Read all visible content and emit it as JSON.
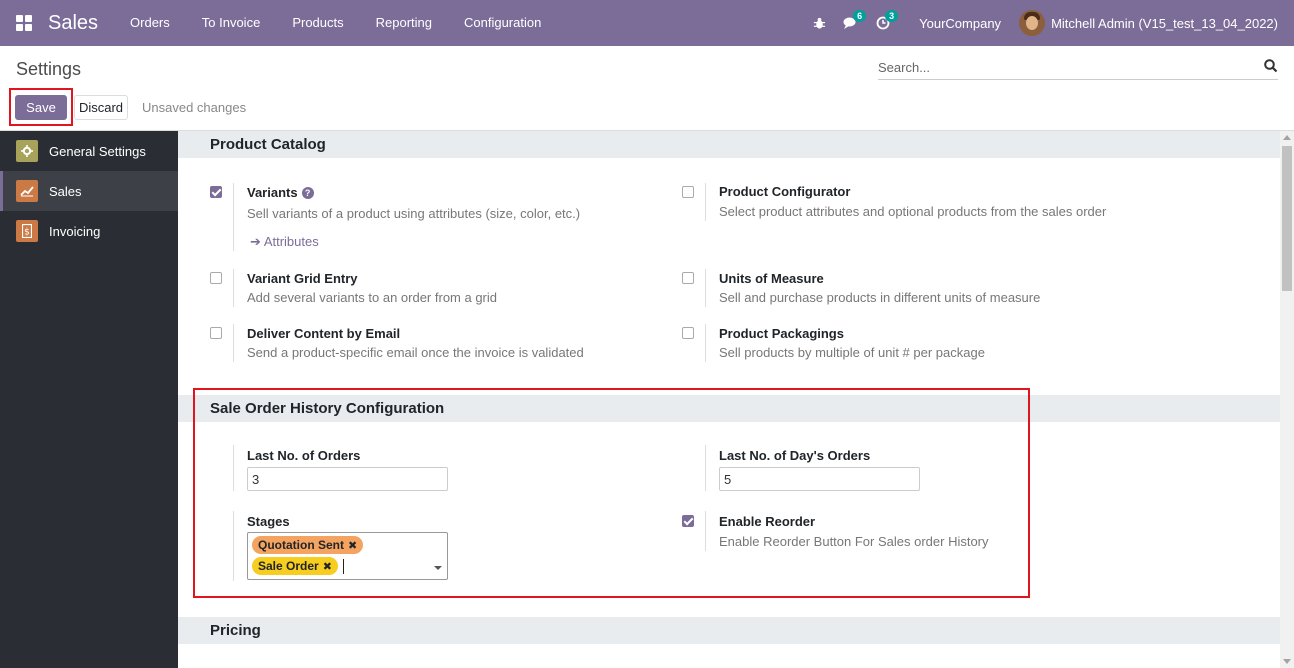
{
  "navbar": {
    "app_name": "Sales",
    "menu": [
      "Orders",
      "To Invoice",
      "Products",
      "Reporting",
      "Configuration"
    ],
    "messages_count": "6",
    "activities_count": "3",
    "company": "YourCompany",
    "user": "Mitchell Admin (V15_test_13_04_2022)",
    "color": "#7c6d98"
  },
  "control": {
    "title": "Settings",
    "search_placeholder": "Search...",
    "save_label": "Save",
    "discard_label": "Discard",
    "unsaved_label": "Unsaved changes"
  },
  "sidebar": {
    "items": [
      {
        "label": "General Settings",
        "icon": "gear-icon",
        "color": "#a8a35a"
      },
      {
        "label": "Sales",
        "icon": "chart-icon",
        "color": "#cc7a45"
      },
      {
        "label": "Invoicing",
        "icon": "invoice-icon",
        "color": "#cc7a45"
      }
    ]
  },
  "product_catalog": {
    "heading": "Product Catalog",
    "variants": {
      "title": "Variants",
      "desc": "Sell variants of a product using attributes (size, color, etc.)",
      "checked": true,
      "link": "Attributes"
    },
    "configurator": {
      "title": "Product Configurator",
      "desc": "Select product attributes and optional products from the sales order",
      "checked": false
    },
    "grid_entry": {
      "title": "Variant Grid Entry",
      "desc": "Add several variants to an order from a grid",
      "checked": false
    },
    "uom": {
      "title": "Units of Measure",
      "desc": "Sell and purchase products in different units of measure",
      "checked": false
    },
    "deliver_email": {
      "title": "Deliver Content by Email",
      "desc": "Send a product-specific email once the invoice is validated",
      "checked": false
    },
    "packagings": {
      "title": "Product Packagings",
      "desc": "Sell products by multiple of unit # per package",
      "checked": false
    }
  },
  "history_config": {
    "heading": "Sale Order History Configuration",
    "last_orders": {
      "label": "Last No. of Orders",
      "value": "3"
    },
    "last_days": {
      "label": "Last No. of Day's Orders",
      "value": "5"
    },
    "stages": {
      "label": "Stages",
      "tags": [
        {
          "label": "Quotation Sent",
          "color": "#f4a460"
        },
        {
          "label": "Sale Order",
          "color": "#f7cd1f"
        }
      ]
    },
    "reorder": {
      "title": "Enable Reorder",
      "desc": "Enable Reorder Button For Sales order History",
      "checked": true
    }
  },
  "pricing": {
    "heading": "Pricing"
  }
}
